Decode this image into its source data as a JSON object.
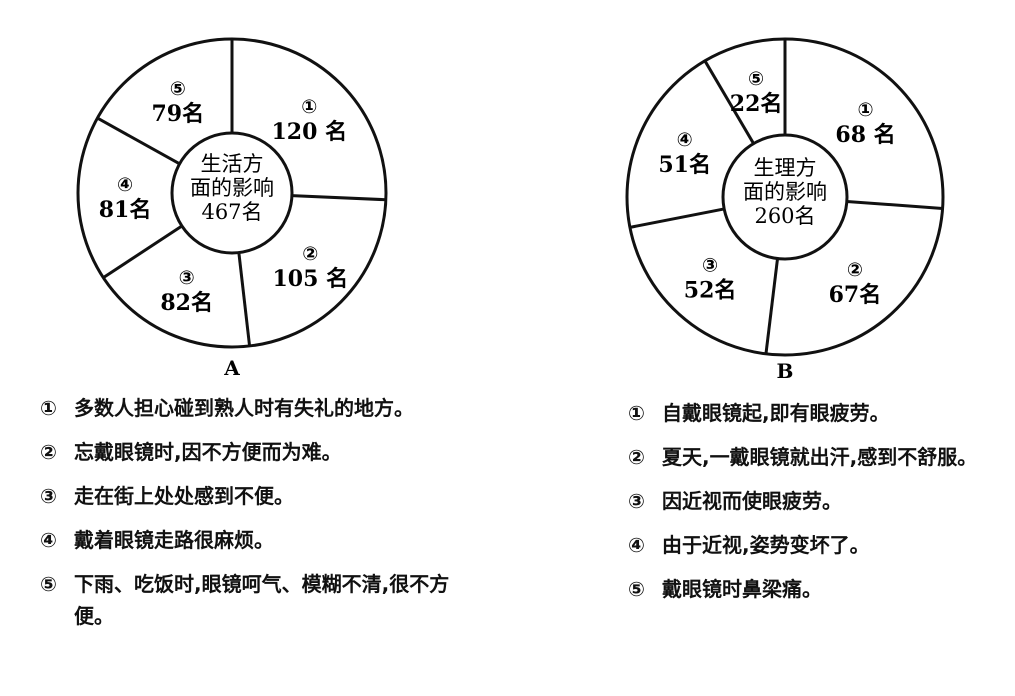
{
  "chart_data": [
    {
      "type": "pie",
      "panel_label": "A",
      "center_label_lines": [
        "生活方",
        "面的影响",
        "467名"
      ],
      "slices": [
        {
          "num": "①",
          "label": "120 名",
          "value": 120
        },
        {
          "num": "②",
          "label": "105 名",
          "value": 105
        },
        {
          "num": "③",
          "label": "82名",
          "value": 82
        },
        {
          "num": "④",
          "label": "81名",
          "value": 81
        },
        {
          "num": "⑤",
          "label": "79名",
          "value": 79
        }
      ],
      "legend": [
        {
          "num": "①",
          "text": "多数人担心碰到熟人时有失礼的地方。"
        },
        {
          "num": "②",
          "text": "忘戴眼镜时,因不方便而为难。"
        },
        {
          "num": "③",
          "text": "走在街上处处感到不便。"
        },
        {
          "num": "④",
          "text": "戴着眼镜走路很麻烦。"
        },
        {
          "num": "⑤",
          "text": "下雨、吃饭时,眼镜呵气、模糊不清,很不方便。"
        }
      ]
    },
    {
      "type": "pie",
      "panel_label": "B",
      "center_label_lines": [
        "生理方",
        "面的影响",
        "260名"
      ],
      "slices": [
        {
          "num": "①",
          "label": "68 名",
          "value": 68
        },
        {
          "num": "②",
          "label": "67名",
          "value": 67
        },
        {
          "num": "③",
          "label": "52名",
          "value": 52
        },
        {
          "num": "④",
          "label": "51名",
          "value": 51
        },
        {
          "num": "⑤",
          "label": "22名",
          "value": 22
        }
      ],
      "legend": [
        {
          "num": "①",
          "text": "自戴眼镜起,即有眼疲劳。"
        },
        {
          "num": "②",
          "text": "夏天,一戴眼镜就出汗,感到不舒服。"
        },
        {
          "num": "③",
          "text": "因近视而使眼疲劳。"
        },
        {
          "num": "④",
          "text": "由于近视,姿势变坏了。"
        },
        {
          "num": "⑤",
          "text": "戴眼镜时鼻梁痛。"
        }
      ]
    }
  ]
}
